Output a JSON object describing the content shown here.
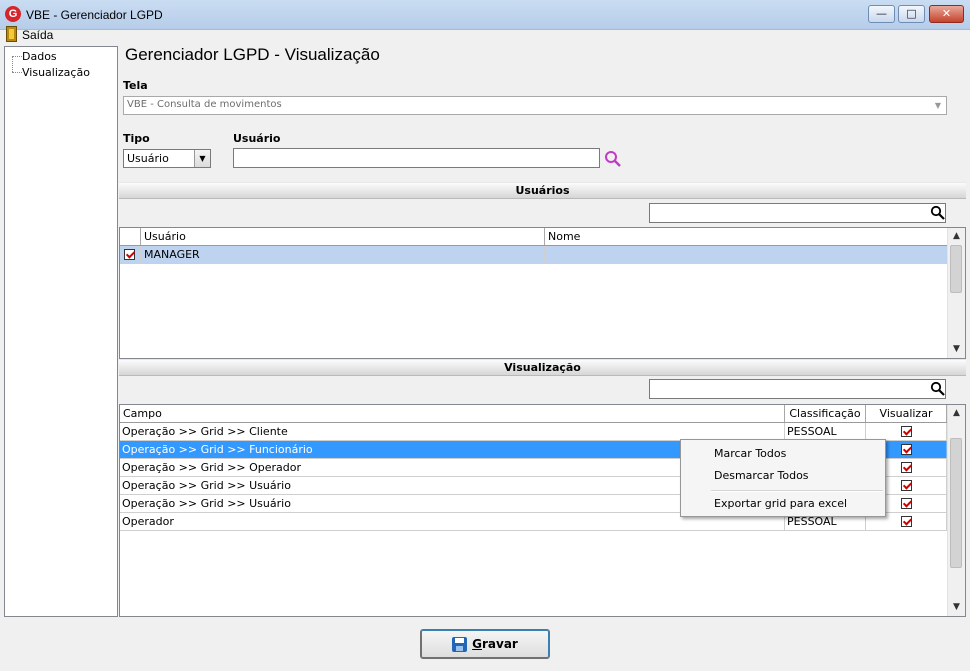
{
  "window": {
    "icon_letter": "G",
    "title": "VBE - Gerenciador LGPD",
    "minimize": "—",
    "maximize": "□",
    "close": "✕"
  },
  "menu": {
    "exit": "Saída"
  },
  "tree": {
    "items": [
      "Dados",
      "Visualização"
    ]
  },
  "page": {
    "title": "Gerenciador LGPD - Visualização"
  },
  "tela": {
    "label": "Tela",
    "value": "VBE - Consulta de movimentos"
  },
  "tipo": {
    "label": "Tipo",
    "value": "Usuário"
  },
  "usuario": {
    "label": "Usuário",
    "value": ""
  },
  "users_section": {
    "title": "Usuários",
    "columns": [
      "Usuário",
      "Nome"
    ],
    "rows": [
      {
        "checked": true,
        "usuario": "MANAGER",
        "nome": ""
      }
    ]
  },
  "view_section": {
    "title": "Visualização",
    "columns": [
      "Campo",
      "Classificação",
      "Visualizar"
    ],
    "rows": [
      {
        "campo": "Operação >> Grid >> Cliente",
        "classificacao": "PESSOAL",
        "visualizar": true
      },
      {
        "campo": "Operação >> Grid >> Funcionário",
        "classificacao": "",
        "visualizar": true
      },
      {
        "campo": "Operação >> Grid >> Operador",
        "classificacao": "",
        "visualizar": true
      },
      {
        "campo": "Operação >> Grid >> Usuário",
        "classificacao": "",
        "visualizar": true
      },
      {
        "campo": "Operação >> Grid >> Usuário",
        "classificacao": "",
        "visualizar": true
      },
      {
        "campo": "Operador",
        "classificacao": "PESSOAL",
        "visualizar": true
      }
    ]
  },
  "context_menu": {
    "items": [
      "Marcar Todos",
      "Desmarcar Todos",
      "Exportar grid para excel"
    ]
  },
  "save_button": {
    "label": "Gravar"
  }
}
